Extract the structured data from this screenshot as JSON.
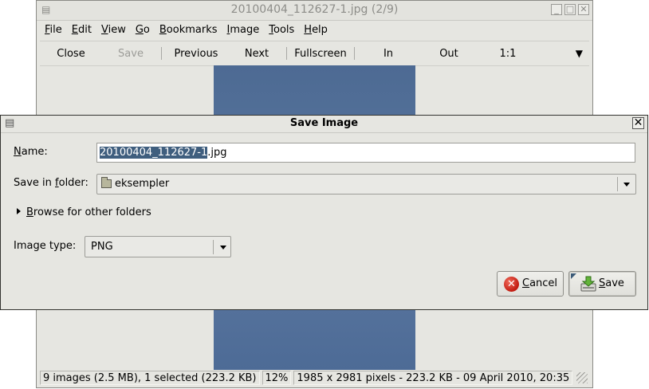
{
  "viewer": {
    "title": "20100404_112627-1.jpg  (2/9)",
    "window_buttons": [
      "_",
      "□",
      "✕"
    ],
    "menu": [
      "File",
      "Edit",
      "View",
      "Go",
      "Bookmarks",
      "Image",
      "Tools",
      "Help"
    ],
    "toolbar": {
      "close": "Close",
      "save": "Save",
      "previous": "Previous",
      "next": "Next",
      "fullscreen": "Fullscreen",
      "zoom_in": "In",
      "zoom_out": "Out",
      "zoom_1to1": "1:1",
      "overflow": "▼"
    },
    "status": {
      "images": "9 images (2.5 MB), 1 selected (223.2 KB)",
      "zoom": "12%",
      "info": "1985 x 2981 pixels - 223.2 KB - 09 April 2010, 20:35"
    }
  },
  "dialog": {
    "title": "Save Image",
    "close_glyph": "✕",
    "name_label": "Name:",
    "name_selected": "20100404_112627-1",
    "name_ext": ".jpg",
    "folder_label": "Save in folder:",
    "folder_value": "eksempler",
    "browse_label": "Browse for other folders",
    "type_label": "Image type:",
    "type_value": "PNG",
    "cancel_label": "Cancel",
    "save_label": "Save",
    "icons": {
      "cancel": "cancel-icon",
      "save": "save-icon",
      "folder": "folder-icon"
    }
  }
}
